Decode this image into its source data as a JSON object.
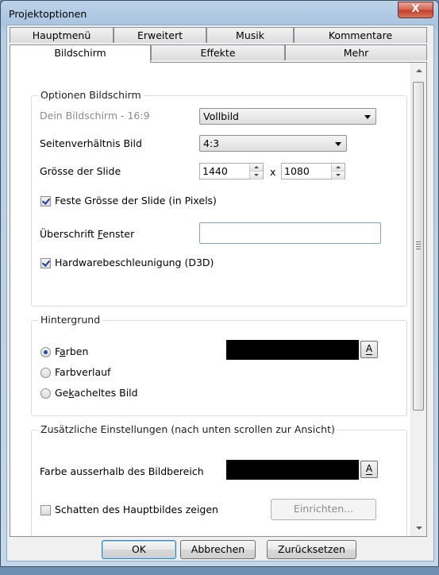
{
  "window": {
    "title": "Projektoptionen",
    "close_label": "X"
  },
  "tabs_back": [
    "Hauptmenü",
    "Erweitert",
    "Musik",
    "Kommentare"
  ],
  "tabs_front": [
    "Bildschirm",
    "Effekte",
    "Mehr"
  ],
  "optionen": {
    "title": "Optionen Bildschirm",
    "screen_label": "Dein Bildschirm - 16:9",
    "screen_value": "Vollbild",
    "aspect_label": "Seitenverhältnis Bild",
    "aspect_value": "4:3",
    "size_label": "Grösse der Slide",
    "width_value": "1440",
    "times": "x",
    "height_value": "1080",
    "fixed_size_label": "Feste Grösse der Slide (in Pixels)",
    "fixed_size_checked": true,
    "window_title_label_pre": "Überschrift ",
    "window_title_label_u": "F",
    "window_title_label_post": "enster",
    "window_title_value": "",
    "hw_label": "Hardwarebeschleunigung (D3D)",
    "hw_checked": true
  },
  "hintergrund": {
    "title": "Hintergrund",
    "farben_pre": "F",
    "farben_u": "a",
    "farben_post": "rben",
    "farbverlauf": "Farbverlauf",
    "kachel_pre": "Ge",
    "kachel_u": "k",
    "kachel_post": "acheltes Bild",
    "selected": "Farben",
    "color": "#000000",
    "a_label": "A"
  },
  "zusatz": {
    "title": "Zusätzliche Einstellungen (nach unten scrollen zur Ansicht)",
    "outside_color_label": "Farbe ausserhalb des Bildbereich",
    "outside_color": "#000000",
    "a_label": "A",
    "shadow_label": "Schatten des Hauptbildes zeigen",
    "shadow_checked": false,
    "setup_button": "Einrichten..."
  },
  "footer": {
    "ok": "OK",
    "cancel": "Abbrechen",
    "reset": "Zurücksetzen"
  }
}
